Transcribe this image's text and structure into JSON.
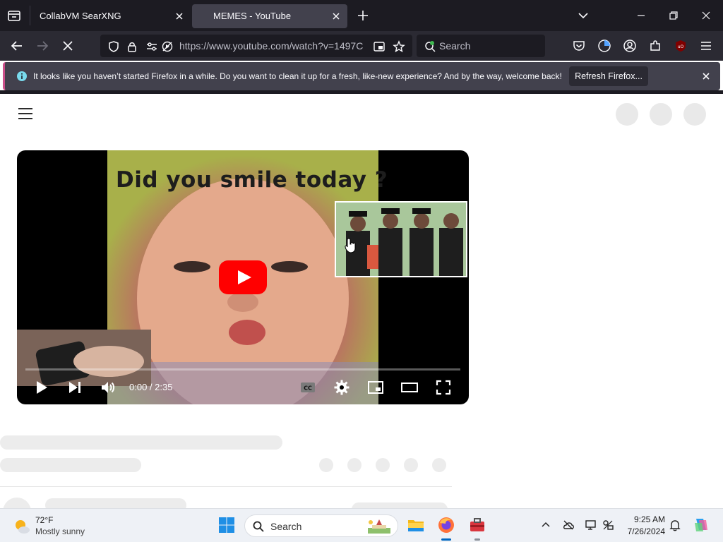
{
  "browser": {
    "tabs": [
      {
        "title": "CollabVM SearXNG",
        "active": false
      },
      {
        "title": "MEMES - YouTube",
        "active": true
      }
    ],
    "url": "https://www.youtube.com/watch?v=1497C",
    "search_placeholder": "Search",
    "notification": {
      "text": "It looks like you haven’t started Firefox in a while. Do you want to clean it up for a fresh, like-new experience? And by the way, welcome back!",
      "button_label": "Refresh Firefox..."
    },
    "accent_color": "#cb4f8a"
  },
  "video": {
    "caption": "Did you smile today ?",
    "time": "0:00 / 2:35",
    "play_button_color": "#ff0000"
  },
  "taskbar": {
    "weather_temp": "72°F",
    "weather_desc": "Mostly sunny",
    "search_placeholder": "Search",
    "time": "9:25 AM",
    "date": "7/26/2024"
  }
}
